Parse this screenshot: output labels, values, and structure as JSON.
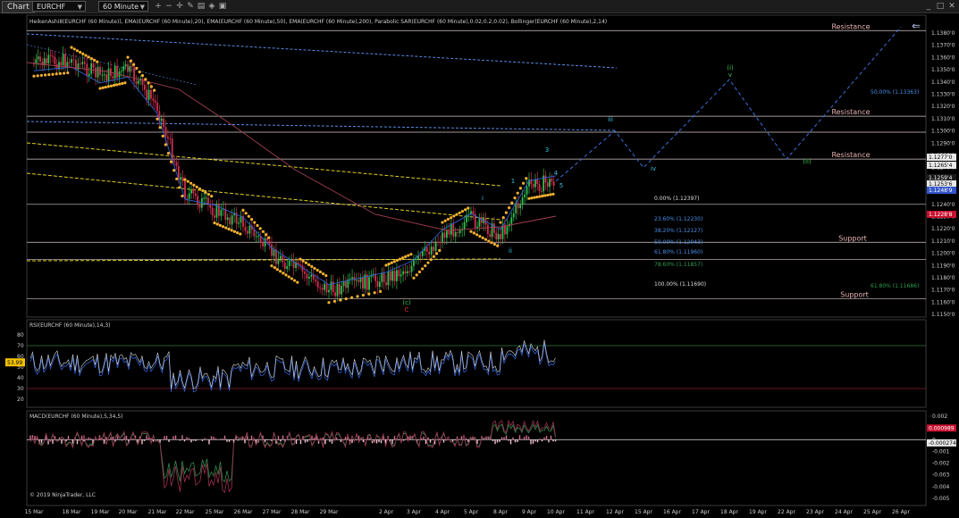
{
  "toolbar": {
    "tab_label": "Chart",
    "instrument": "EURCHF",
    "interval": "60 Minute",
    "icons": [
      "zoom-in-icon",
      "zoom-out-icon",
      "crosshair-icon",
      "draw-icon",
      "properties-icon",
      "strategy-icon",
      "template-icon",
      "window-min-icon",
      "window-max-icon",
      "window-close-icon"
    ]
  },
  "main_panel": {
    "indicator_label": "HeikenAshi8(EURCHF (60 Minute)), EMA(EURCHF (60 Minute),20), EMA(EURCHF (60 Minute),50), EMA(EURCHF (60 Minute),200), Parabolic SAR(EURCHF (60 Minute),0.02,0.2,0.02), Bollinger(EURCHF (60 Minute),2,14)",
    "y_ticks": [
      "1.1380'0",
      "1.1370'0",
      "1.1360'0",
      "1.1350'0",
      "1.1340'0",
      "1.1330'0",
      "1.1320'0",
      "1.1310'0",
      "1.1300'0",
      "1.1290'0",
      "1.1280'0",
      "1.1270'0",
      "1.1260'0",
      "1.1250'0",
      "1.1240'0",
      "1.1230'0",
      "1.1220'0",
      "1.1210'0",
      "1.1200'0",
      "1.1190'0",
      "1.1180'0",
      "1.1170'0",
      "1.1160'0",
      "1.1150'0"
    ],
    "sr_labels": [
      {
        "text": "Resistance",
        "price": 1.1382
      },
      {
        "text": "Resistance",
        "price": 1.1312
      },
      {
        "text": "Resistance",
        "price": 1.1277
      },
      {
        "text": "Support",
        "price": 1.1209
      },
      {
        "text": "Support",
        "price": 1.1163
      }
    ],
    "price_badges": [
      {
        "text": "1.1277'0",
        "price": 1.1277,
        "color": "#e8e8e8",
        "fg": "#000"
      },
      {
        "text": "1.1265'4",
        "price": 1.12654,
        "color": "#e8e8e8",
        "fg": "#000"
      },
      {
        "text": "1.1259'4",
        "price": 1.12594,
        "color": "#1a1a1a",
        "fg": "#fff"
      },
      {
        "text": "1.1253'6",
        "price": 1.12536,
        "color": "#e8e8e8",
        "fg": "#000"
      },
      {
        "text": "1.1248'9",
        "price": 1.12489,
        "color": "#3355cc",
        "fg": "#fff"
      },
      {
        "text": "1.1228'8",
        "price": 1.12288,
        "color": "#c8102e",
        "fg": "#fff"
      }
    ],
    "fib_levels": [
      {
        "text": "0.00% (1.12397)",
        "color": "#dddddd"
      },
      {
        "text": "23.60% (1.12230)",
        "color": "#4a8fe7"
      },
      {
        "text": "38.20% (1.12127)",
        "color": "#4a8fe7"
      },
      {
        "text": "50.00% (1.12043)",
        "color": "#4a8fe7"
      },
      {
        "text": "61.80% (1.11960)",
        "color": "#4a8fe7"
      },
      {
        "text": "78.60% (1.11857)",
        "color": "#2e9e4f"
      },
      {
        "text": "100.00% (1.11690)",
        "color": "#dddddd"
      }
    ],
    "fib_ext_top": "50.00% (1.13363)",
    "fib_ext_bottom": "61.80% (1.11686)",
    "wave_labels": [
      {
        "text": "iii",
        "color": "#35c0e0"
      },
      {
        "text": "iv",
        "color": "#35c0e0"
      },
      {
        "text": "(i)",
        "color": "#3cc050"
      },
      {
        "text": "v",
        "color": "#3cc050"
      },
      {
        "text": "(ii)",
        "color": "#3cc050"
      },
      {
        "text": "i",
        "color": "#35c0e0"
      },
      {
        "text": "ii",
        "color": "#35c0e0"
      },
      {
        "text": "3",
        "color": "#35c0e0"
      },
      {
        "text": "4",
        "color": "#35c0e0"
      },
      {
        "text": "5",
        "color": "#35c0e0"
      },
      {
        "text": "(c)",
        "color": "#3cc050"
      },
      {
        "text": "C",
        "color": "#e03030"
      },
      {
        "text": "1",
        "color": "#35c0e0"
      }
    ]
  },
  "rsi_panel": {
    "label": "RSI(EURCHF (60 Minute),14,3)",
    "y_ticks": [
      "80",
      "70",
      "60",
      "50",
      "40",
      "30",
      "20"
    ],
    "value_badge": "53.99"
  },
  "macd_panel": {
    "label": "MACD(EURCHF (60 Minute),5,34,5)",
    "y_ticks": [
      "0.002",
      "0.001",
      "0",
      "-0.001",
      "-0.002",
      "-0.003",
      "-0.004",
      "-0.005"
    ],
    "value_badges": [
      "0.000989",
      "-0.000274"
    ],
    "copyright": "© 2019 NinjaTrader, LLC"
  },
  "x_ticks": [
    "15 Mar",
    "18 Mar",
    "19 Mar",
    "20 Mar",
    "21 Mar",
    "22 Mar",
    "25 Mar",
    "26 Mar",
    "27 Mar",
    "28 Mar",
    "29 Mar",
    "2 Apr",
    "3 Apr",
    "4 Apr",
    "5 Apr",
    "8 Apr",
    "9 Apr",
    "10 Apr",
    "11 Apr",
    "12 Apr",
    "15 Apr",
    "16 Apr",
    "17 Apr",
    "18 Apr",
    "19 Apr",
    "22 Apr",
    "23 Apr",
    "24 Apr",
    "25 Apr",
    "26 Apr"
  ],
  "colors": {
    "background": "#000000",
    "resistance": "#e8b0b0",
    "projection": "#3a6fd8",
    "trend_yellow": "#e0d020",
    "trend_blue": "#5a8ae0",
    "psar": "#f0b030"
  },
  "chart_data": {
    "type": "candlestick",
    "title": "",
    "ylim": [
      1.1145,
      1.1392
    ],
    "approx_close_path": [
      [
        "15 Mar",
        1.1355
      ],
      [
        "18 Mar",
        1.1358
      ],
      [
        "19 Mar",
        1.1345
      ],
      [
        "20 Mar",
        1.135
      ],
      [
        "21 Mar",
        1.132
      ],
      [
        "22 Mar",
        1.125
      ],
      [
        "25 Mar",
        1.1235
      ],
      [
        "26 Mar",
        1.1225
      ],
      [
        "27 Mar",
        1.12
      ],
      [
        "28 Mar",
        1.1185
      ],
      [
        "29 Mar",
        1.117
      ],
      [
        "2 Apr",
        1.118
      ],
      [
        "3 Apr",
        1.119
      ],
      [
        "4 Apr",
        1.1215
      ],
      [
        "5 Apr",
        1.1228
      ],
      [
        "8 Apr",
        1.1215
      ],
      [
        "9 Apr",
        1.1255
      ],
      [
        "10 Apr",
        1.1259
      ]
    ],
    "projection_path": [
      [
        "10 Apr",
        1.1259
      ],
      [
        "12 Apr",
        1.13
      ],
      [
        "15 Apr",
        1.127
      ],
      [
        "18 Apr",
        1.1342
      ],
      [
        "22 Apr",
        1.1277
      ],
      [
        "26 Apr",
        1.1385
      ]
    ],
    "rsi": {
      "ylim": [
        20,
        80
      ],
      "last": 53.99
    },
    "macd": {
      "ylim": [
        -0.005,
        0.002
      ],
      "last": [
        0.000989,
        -0.000274
      ]
    }
  }
}
